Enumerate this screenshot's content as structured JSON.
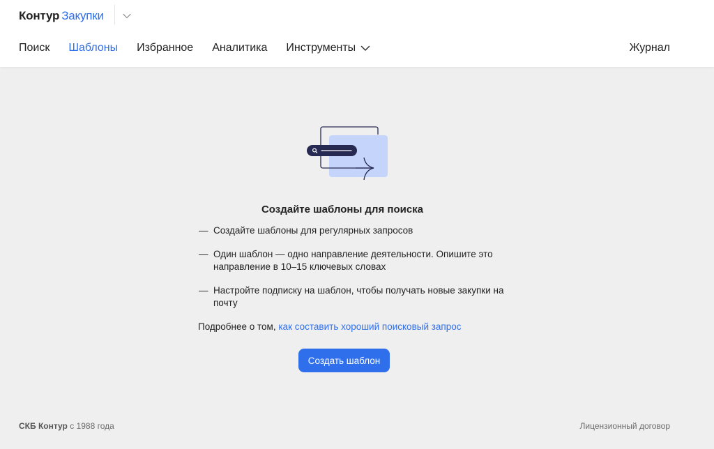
{
  "header": {
    "logo": {
      "brand": "Контур",
      "product": "Закупки"
    },
    "nav": [
      {
        "label": "Поиск",
        "active": false
      },
      {
        "label": "Шаблоны",
        "active": true
      },
      {
        "label": "Избранное",
        "active": false
      },
      {
        "label": "Аналитика",
        "active": false
      },
      {
        "label": "Инструменты",
        "active": false,
        "has_dropdown": true
      }
    ],
    "journal_label": "Журнал"
  },
  "empty_state": {
    "title": "Создайте шаблоны для поиска",
    "tips": [
      "Создайте шаблоны для регулярных запросов",
      "Один шаблон — одно направление деятельности. Опишите это направление в 10–15 ключевых словах",
      "Настройте подписку на шаблон, чтобы получать новые закупки на почту"
    ],
    "tip_marker": "—",
    "more_prefix": "Подробнее о том,",
    "more_link": "как составить хороший поисковый запрос",
    "create_button": "Создать шаблон"
  },
  "footer": {
    "company": "СКБ Контур",
    "since": "с 1988 года",
    "license_link": "Лицензионный договор"
  },
  "colors": {
    "accent": "#2f6fec",
    "background": "#efefef",
    "header": "#ffffff",
    "illustration_fill": "#c5d4fb",
    "illustration_dark": "#262a52"
  },
  "icons": {
    "product_switch": "chevron-down-icon",
    "tools_dropdown": "chevron-down-icon",
    "illustration": "search-template-illustration"
  }
}
